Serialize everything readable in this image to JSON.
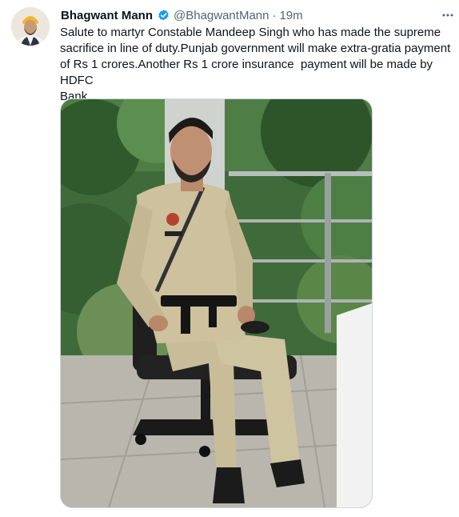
{
  "tweet": {
    "author_name": "Bhagwant Mann",
    "handle": "@BhagwantMann",
    "separator": "·",
    "time": "19m",
    "text": "Salute to martyr Constable Mandeep Singh who has made the supreme\nsacrifice in line of duty.Punjab government will make extra-gratia payment\nof Rs 1 crores.Another Rs 1 crore insurance  payment will be made by HDFC\nBank"
  },
  "icons": {
    "verified": "verified-badge-icon",
    "more": "more-options-icon"
  },
  "colors": {
    "verified": "#1d9bf0",
    "secondary_text": "#536471",
    "primary_text": "#0f1419"
  }
}
